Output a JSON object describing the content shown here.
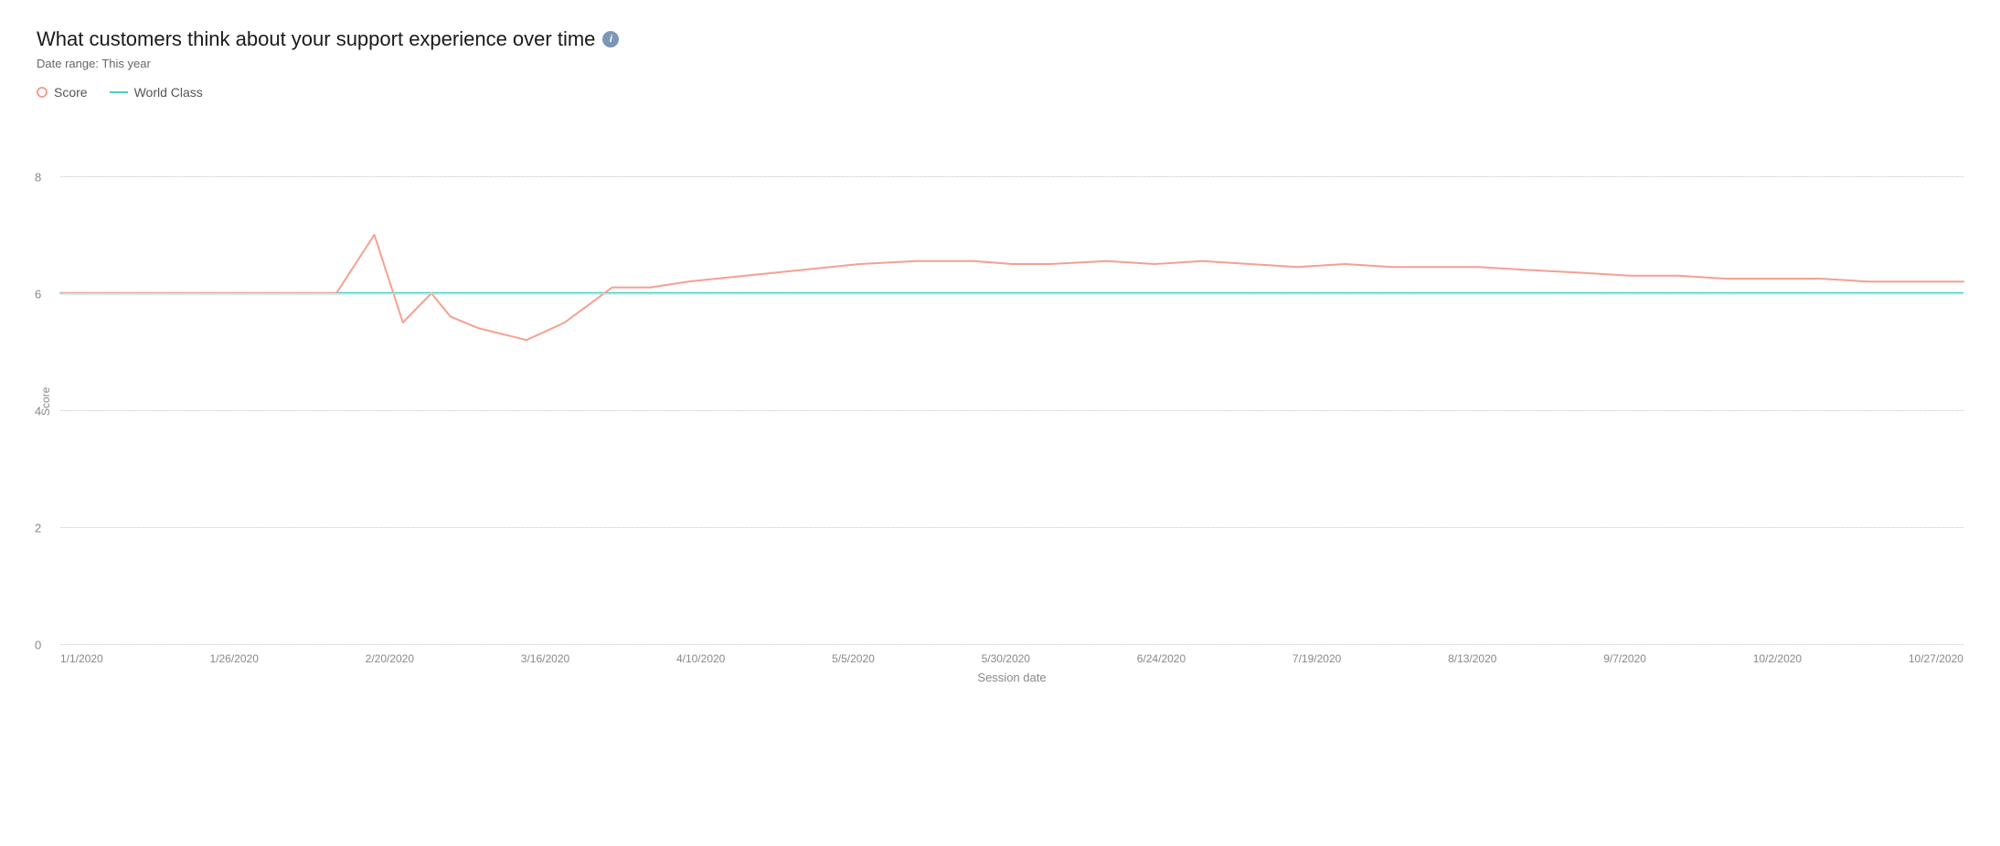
{
  "chart": {
    "title": "What customers think about your support experience over time",
    "date_range_label": "Date range:",
    "date_range_value": "This year",
    "y_axis_label": "Score",
    "x_axis_label": "Session date",
    "legend": {
      "score_label": "Score",
      "world_class_label": "World Class"
    },
    "info_icon_label": "i",
    "y_ticks": [
      {
        "value": 0,
        "label": "0"
      },
      {
        "value": 2,
        "label": "2"
      },
      {
        "value": 4,
        "label": "4"
      },
      {
        "value": 6,
        "label": "6"
      },
      {
        "value": 8,
        "label": "8"
      }
    ],
    "x_ticks": [
      "1/1/2020",
      "1/26/2020",
      "2/20/2020",
      "3/16/2020",
      "4/10/2020",
      "5/5/2020",
      "5/30/2020",
      "6/24/2020",
      "7/19/2020",
      "8/13/2020",
      "9/7/2020",
      "10/2/2020",
      "10/27/2020"
    ],
    "world_class_value": 6,
    "y_max": 9,
    "colors": {
      "score_line": "#f5a090",
      "world_class_line": "#4ecdc4",
      "grid": "#e0e0e0"
    }
  }
}
